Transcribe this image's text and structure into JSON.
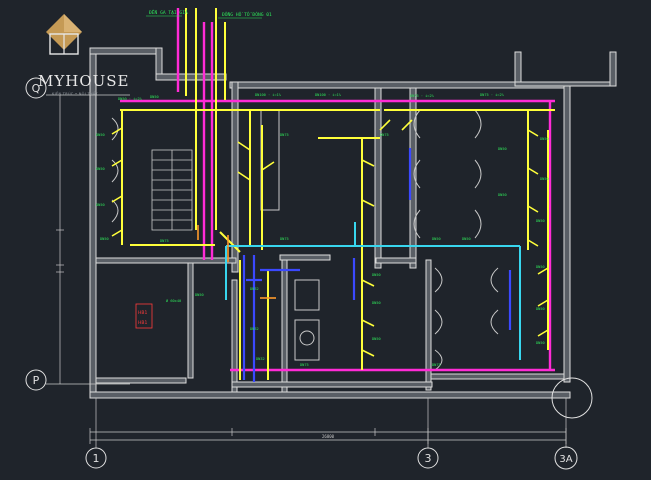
{
  "logo": {
    "title": "MYHOUSE",
    "subtitle": "KIẾN TRÚC • NỘI THẤT",
    "colors": {
      "box": "#c59a55",
      "box_dark": "#9c7338",
      "text": "#e7e7e7"
    }
  },
  "drawing": {
    "top_notes": [
      "ĐẾN GA TẠI GIÁ",
      "ĐỒNG HỒ TỔ ĐÓNG 01"
    ],
    "grid_labels": {
      "row_top": "Q",
      "row_bottom": "P",
      "col_left": "1",
      "col_mid": "3",
      "col_right": "3A"
    },
    "room_tags": [
      "HB1",
      "HB1"
    ],
    "duct_tag": "Ø 60x40",
    "dimension_overall": "26800",
    "colors": {
      "background": "#1f242b",
      "wall": "#dcdcdc",
      "wall_fill": "#5a5f66",
      "fixture": "#c8c8c8",
      "pipe_yellow": "#ffff3a",
      "pipe_magenta": "#ff2bd6",
      "pipe_cyan": "#38d6ee",
      "pipe_blue": "#3b49ff",
      "pipe_orange": "#ff9a2a",
      "label_green": "#2ee65a",
      "tag_red": "#ff3b3b"
    }
  }
}
